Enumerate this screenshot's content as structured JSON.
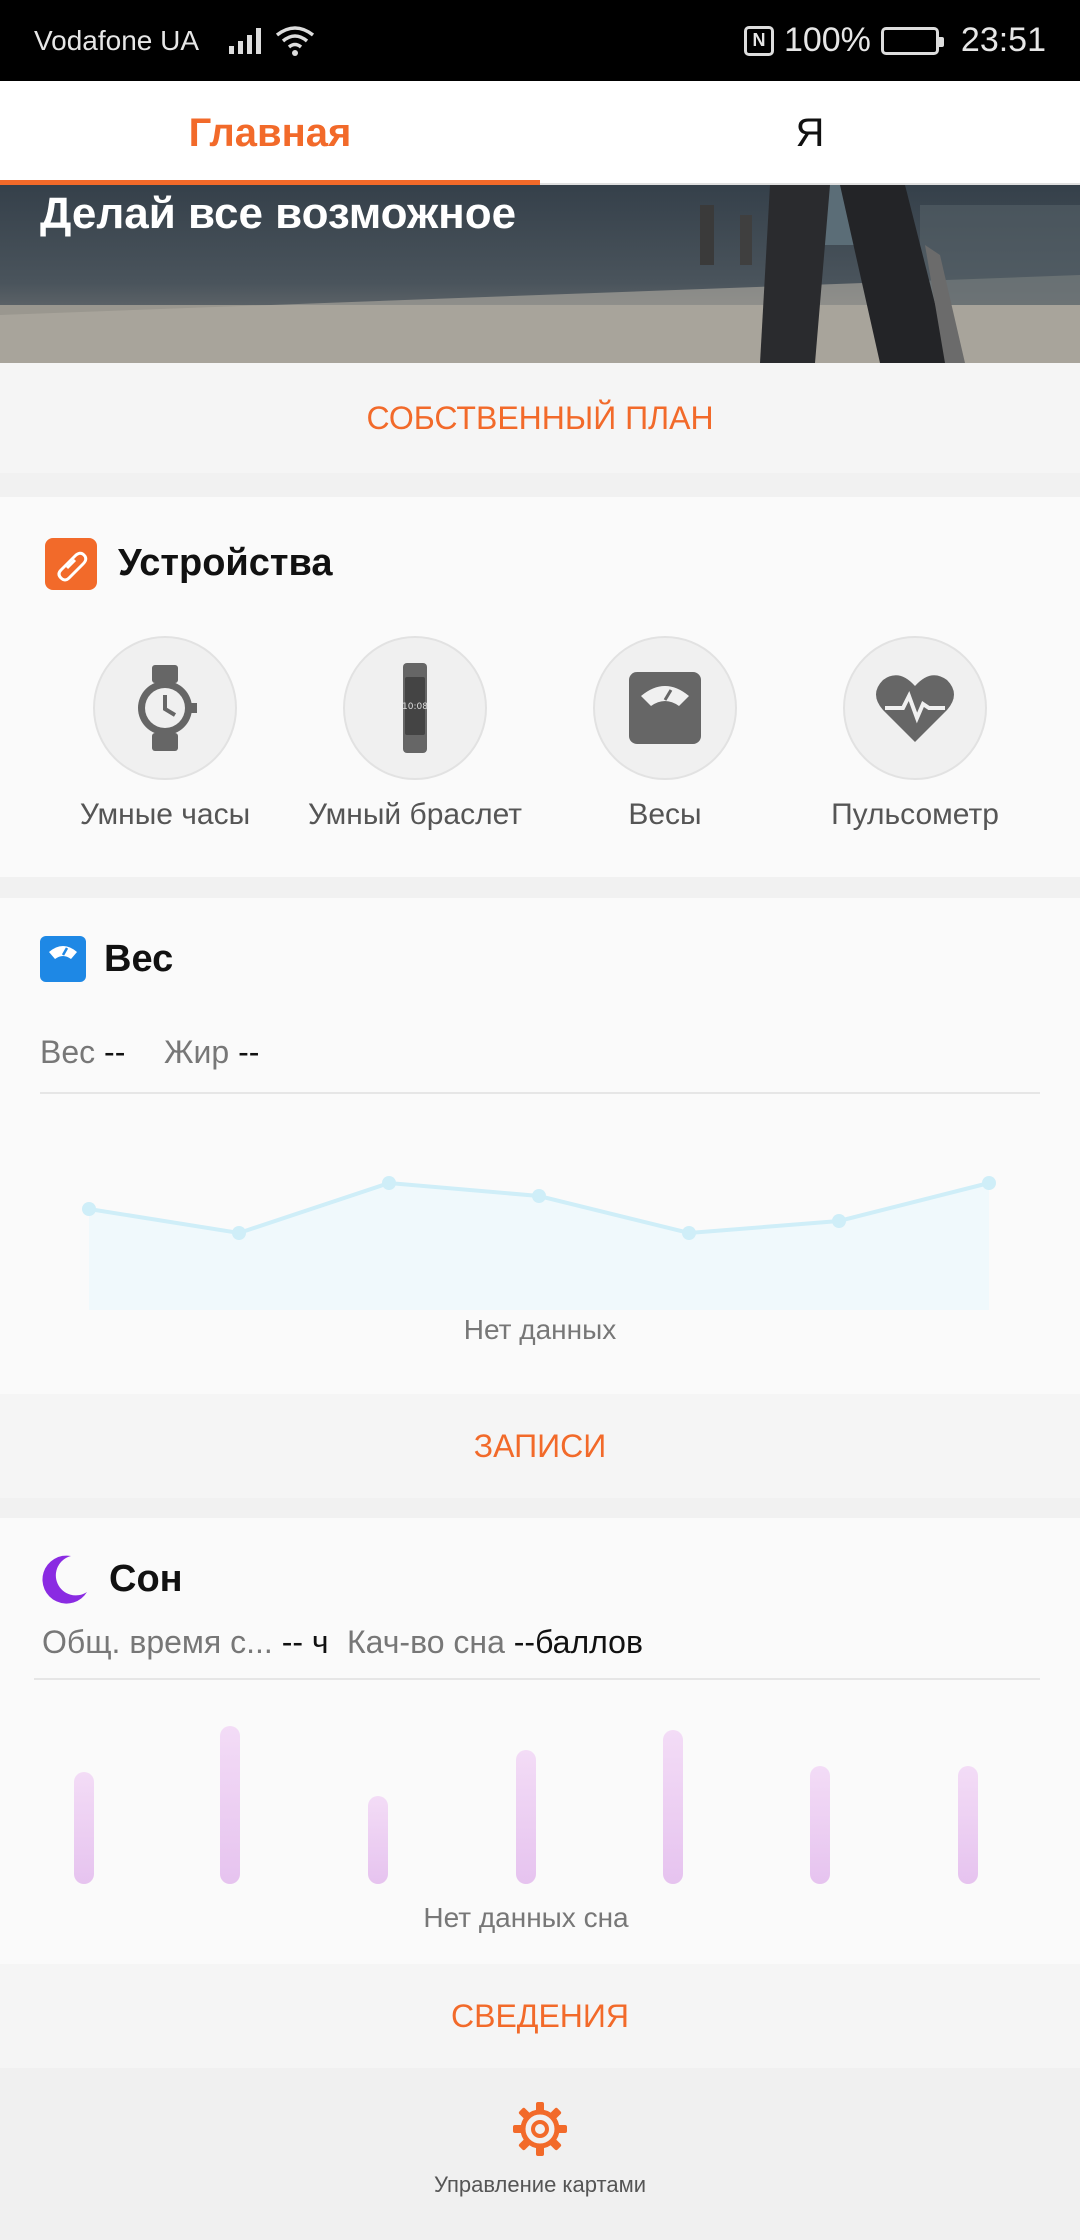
{
  "status": {
    "carrier": "Vodafone UA",
    "battery": "100%",
    "time": "23:51"
  },
  "tabs": [
    {
      "label": "Главная",
      "active": true
    },
    {
      "label": "Я",
      "active": false
    }
  ],
  "banner": {
    "title": "Делай все возможное"
  },
  "plan": {
    "action_label": "СОБСТВЕННЫЙ ПЛАН"
  },
  "devices": {
    "title": "Устройства",
    "items": [
      {
        "label": "Умные часы",
        "icon": "smart-watch-icon"
      },
      {
        "label": "Умный браслет",
        "icon": "smart-band-icon"
      },
      {
        "label": "Весы",
        "icon": "scale-icon"
      },
      {
        "label": "Пульсометр",
        "icon": "heart-rate-icon"
      }
    ]
  },
  "weight": {
    "title": "Вес",
    "weight_label": "Вес",
    "weight_value": "--",
    "fat_label": "Жир",
    "fat_value": "--",
    "no_data": "Нет данных",
    "action_label": "ЗАПИСИ"
  },
  "sleep": {
    "title": "Сон",
    "total_label": "Общ. время с...",
    "total_value": "--",
    "total_unit": "ч",
    "quality_label": "Кач-во сна",
    "quality_value": "--",
    "quality_unit": "баллов",
    "no_data": "Нет данных сна",
    "action_label": "СВЕДЕНИЯ"
  },
  "footer": {
    "manage_label": "Управление картами"
  },
  "colors": {
    "accent": "#f26a2a",
    "weight_line": "#cfeef8",
    "sleep_bar": "#e9c6f0",
    "sleep_icon": "#8a2be2",
    "scale_badge": "#1e88e5"
  }
}
